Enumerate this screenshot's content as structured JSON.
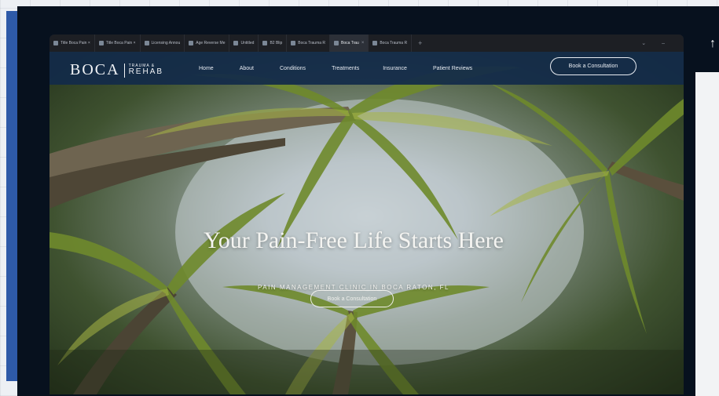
{
  "browser": {
    "tabs": [
      {
        "label": "Title Boca Pain ×",
        "active": false
      },
      {
        "label": "Title Boca Pain ×",
        "active": false
      },
      {
        "label": "Licensing Annou",
        "active": false
      },
      {
        "label": "Age Reverse Me",
        "active": false
      },
      {
        "label": "Untitled",
        "active": false
      },
      {
        "label": "B2 Blip",
        "active": false
      },
      {
        "label": "Boca Trauma R",
        "active": false
      },
      {
        "label": "Boca Trau",
        "active": true
      },
      {
        "label": "Boca Trauma R",
        "active": false
      }
    ],
    "new_tab_symbol": "+",
    "dropdown_symbol": "⌄",
    "minimize_symbol": "–"
  },
  "site": {
    "logo": {
      "main": "BOCA",
      "sub_top": "TRAUMA &",
      "sub_bottom": "REHAB"
    },
    "nav": [
      "Home",
      "About",
      "Conditions",
      "Treatments",
      "Insurance",
      "Patient Reviews"
    ],
    "nav_cta": "Book a Consultation",
    "hero_title": "Your Pain-Free Life Starts Here",
    "hero_subtitle": "PAIN MANAGEMENT CLINIC IN BOCA RATON, FL",
    "hero_cta": "Book a Consultation"
  },
  "colors": {
    "nav_bg": "#122a4a",
    "frame": "#07111e",
    "accent_bar": "#2e5aa8"
  },
  "right_edge_glyph": "↑"
}
